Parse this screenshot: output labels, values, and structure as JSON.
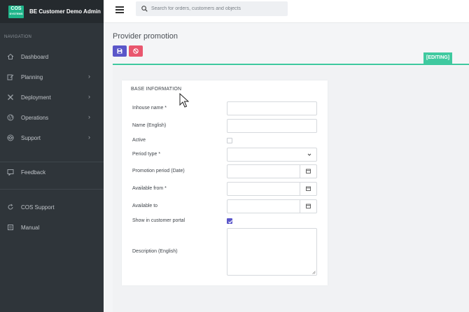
{
  "brand": {
    "logo_line1": "COS",
    "logo_line2": "SYSTEMS",
    "title": "BE Customer Demo Admin"
  },
  "sidebar": {
    "section_title": "NAVIGATION",
    "items": [
      {
        "label": "Dashboard",
        "icon": "home-icon",
        "has_children": false
      },
      {
        "label": "Planning",
        "icon": "edit-icon",
        "has_children": true
      },
      {
        "label": "Deployment",
        "icon": "tools-icon",
        "has_children": true
      },
      {
        "label": "Operations",
        "icon": "globe-icon",
        "has_children": true
      },
      {
        "label": "Support",
        "icon": "lifebuoy-icon",
        "has_children": true
      },
      {
        "label": "Feedback",
        "icon": "comment-icon",
        "has_children": false
      },
      {
        "label": "COS Support",
        "icon": "refresh-icon",
        "has_children": false
      },
      {
        "label": "Manual",
        "icon": "book-icon",
        "has_children": false
      }
    ]
  },
  "topbar": {
    "search_placeholder": "Search for orders, customers and objects"
  },
  "page": {
    "title": "Provider promotion",
    "status_badge": "[EDITING]"
  },
  "form": {
    "section_title": "BASE INFORMATION",
    "fields": {
      "inhouse_name": {
        "label": "Inhouse name *",
        "value": ""
      },
      "name_english": {
        "label": "Name (English)",
        "value": ""
      },
      "active": {
        "label": "Active",
        "checked": false
      },
      "period_type": {
        "label": "Period type *",
        "value": ""
      },
      "promotion_period": {
        "label": "Promotion period (Date)",
        "value": ""
      },
      "available_from": {
        "label": "Available from *",
        "value": ""
      },
      "available_to": {
        "label": "Available to",
        "value": ""
      },
      "show_in_portal": {
        "label": "Show in customer portal",
        "checked": true
      },
      "description_english": {
        "label": "Description (English)",
        "value": ""
      }
    }
  },
  "colors": {
    "sidebar_bg": "#2f353a",
    "accent_purple": "#5a56c9",
    "accent_red": "#e9566e",
    "accent_green": "#3fc99f",
    "logo_green": "#1fb58a"
  }
}
